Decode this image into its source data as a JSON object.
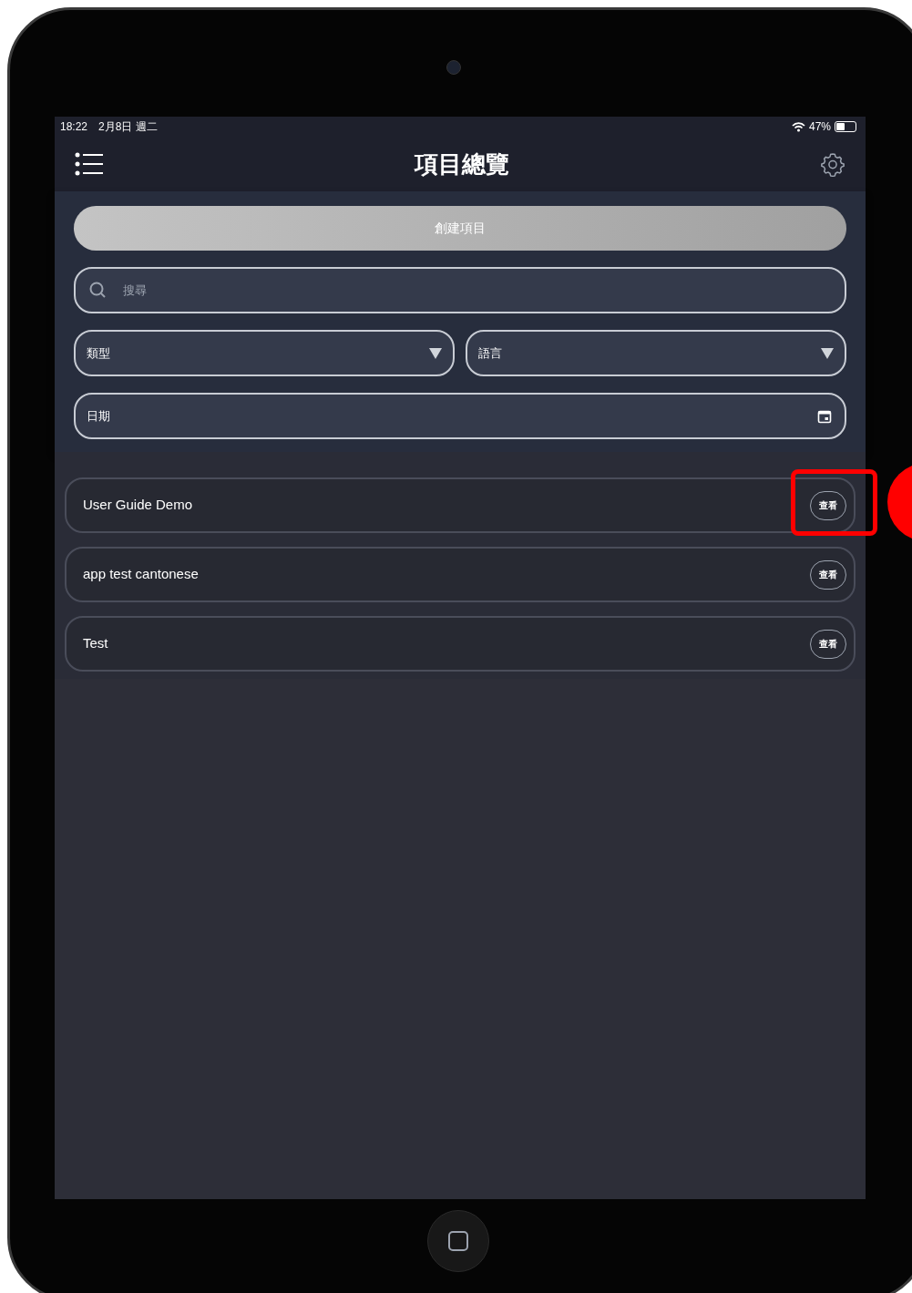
{
  "status_bar": {
    "time": "18:22",
    "date": "2月8日 週二",
    "battery": "47%"
  },
  "nav": {
    "title": "項目總覽"
  },
  "create_button": {
    "label": "創建項目"
  },
  "search": {
    "placeholder": "搜尋"
  },
  "filters": [
    {
      "label": "類型"
    },
    {
      "label": "語言"
    }
  ],
  "date_field": {
    "label": "日期"
  },
  "projects": [
    {
      "name": "User Guide Demo",
      "action": "查看",
      "highlighted": true
    },
    {
      "name": "app test cantonese",
      "action": "查看",
      "highlighted": false
    },
    {
      "name": "Test",
      "action": "查看",
      "highlighted": false
    }
  ]
}
